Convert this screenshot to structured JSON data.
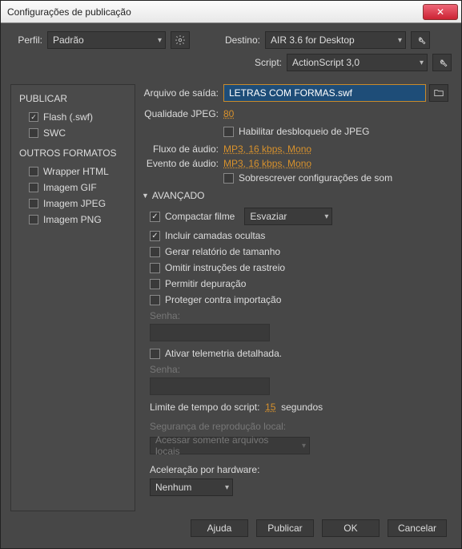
{
  "window": {
    "title": "Configurações de publicação"
  },
  "profile": {
    "label": "Perfil:",
    "value": "Padrão"
  },
  "target": {
    "label": "Destino:",
    "value": "AIR 3.6 for Desktop"
  },
  "script": {
    "label": "Script:",
    "value": "ActionScript 3,0"
  },
  "sidebar": {
    "publish_head": "PUBLICAR",
    "other_head": "OUTROS FORMATOS",
    "flash": "Flash (.swf)",
    "swc": "SWC",
    "wrapper": "Wrapper HTML",
    "gif": "Imagem GIF",
    "jpeg": "Imagem JPEG",
    "png": "Imagem PNG"
  },
  "output": {
    "file_label": "Arquivo de saída:",
    "file_value": "LETRAS COM FORMAS.swf",
    "jpeg_q_label": "Qualidade JPEG:",
    "jpeg_q_value": "80",
    "jpeg_unlock": "Habilitar desbloqueio de JPEG",
    "audio_flow_label": "Fluxo de áudio:",
    "audio_flow_value": "MP3, 16 kbps, Mono",
    "audio_event_label": "Evento de áudio:",
    "audio_event_value": "MP3, 16 kbps, Mono",
    "override_sound": "Sobrescrever configurações de som"
  },
  "advanced": {
    "head": "AVANÇADO",
    "compact": "Compactar filme",
    "compact_mode": "Esvaziar",
    "hidden_layers": "Incluir camadas ocultas",
    "size_report": "Gerar relatório de tamanho",
    "omit_trace": "Omitir instruções de rastreio",
    "allow_debug": "Permitir depuração",
    "protect_import": "Proteger contra importação",
    "password_label": "Senha:",
    "telemetry": "Ativar telemetria detalhada.",
    "script_limit_pre": "Limite de tempo do script:",
    "script_limit_val": "15",
    "script_limit_suf": "segundos",
    "local_sec_label": "Segurança de reprodução local:",
    "local_sec_value": "Acessar somente arquivos locais",
    "hw_label": "Aceleração por hardware:",
    "hw_value": "Nenhum"
  },
  "footer": {
    "help": "Ajuda",
    "publish": "Publicar",
    "ok": "OK",
    "cancel": "Cancelar"
  }
}
